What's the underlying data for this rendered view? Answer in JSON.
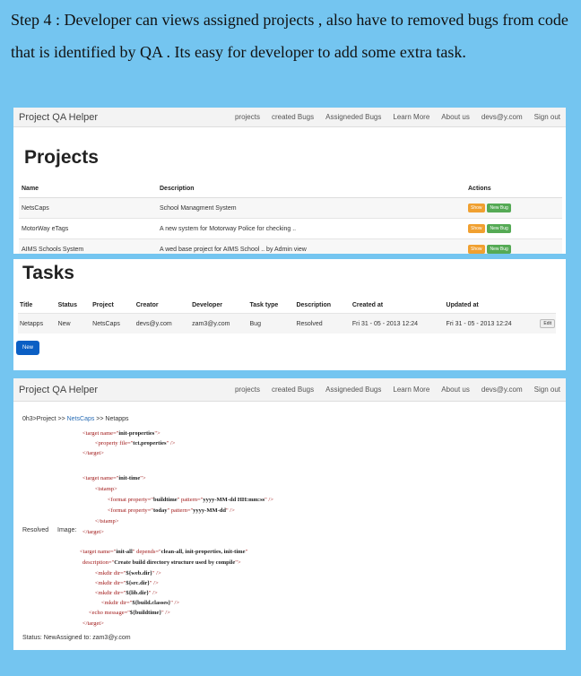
{
  "caption": "Step 4 : Developer can views assigned projects , also have to removed bugs from code that is identified by QA . Its easy for developer to add some extra task.",
  "navbar": {
    "brand": "Project QA Helper",
    "links": [
      "projects",
      "created Bugs",
      "Assigneded Bugs",
      "Learn More",
      "About us",
      "devs@y.com",
      "Sign out"
    ]
  },
  "projects": {
    "title": "Projects",
    "headers": [
      "Name",
      "Description",
      "Actions"
    ],
    "rows": [
      {
        "name": "NetsCaps",
        "description": "School Managment System"
      },
      {
        "name": "MotorWay eTags",
        "description": "A new system for Motorway Police for checking .."
      },
      {
        "name": "AIMS Schools System",
        "description": "A wed base project for AIMS School .. by Admin view"
      }
    ],
    "show_label": "Show",
    "newbug_label": "New Bug"
  },
  "tasks": {
    "title": "Tasks",
    "headers": [
      "Title",
      "Status",
      "Project",
      "Creator",
      "Developer",
      "Task type",
      "Description",
      "Created at",
      "Updated at"
    ],
    "row": [
      "Netapps",
      "New",
      "NetsCaps",
      "devs@y.com",
      "zam3@y.com",
      "Bug",
      "Resolved",
      "Fri 31 - 05 - 2013 12:24",
      "Fri 31 - 05 - 2013 12:24"
    ],
    "edit_label": "Edit",
    "new_label": "New"
  },
  "detail": {
    "crumb_prefix": "0h3>Project >> ",
    "crumb_link": "NetsCaps",
    "crumb_suffix": " >> Netapps",
    "resolved": "Resolved",
    "image_label": "Image:",
    "status_line": "Status: NewAssigned to: zam3@y.com",
    "code": {
      "l1": [
        "<target name=\"",
        "init-properties",
        "\">"
      ],
      "l2": [
        "<property file=\"",
        "tct.properties",
        "\" />"
      ],
      "l3": "</target>",
      "l4": [
        "<target name=\"",
        "init-time",
        "\">"
      ],
      "l5": "<tstamp>",
      "l6": [
        "<format property=\"",
        "buildtime",
        "\" pattern=\"",
        "yyyy-MM-dd HH:mm:ss",
        "\" />"
      ],
      "l7": [
        "<format property=\"",
        "today",
        "\" pattern=\"",
        "yyyy-MM-dd",
        "\" />"
      ],
      "l8": "</tstamp>",
      "l9": "</target>",
      "l10": [
        "<target name=\"",
        "init-all",
        "\" depends=\"",
        "clean-all, init-properties, init-time",
        "\""
      ],
      "l11": [
        "description=\"",
        "Create build directory structure used by compile",
        "\">"
      ],
      "l12": [
        "<mkdir dir=\"",
        "${web.dir}",
        "\" />"
      ],
      "l13": [
        "<mkdir dir=\"",
        "${src.dir}",
        "\" />"
      ],
      "l14": [
        "<mkdir dir=\"",
        "${lib.dir}",
        "\" />"
      ],
      "l15": [
        "<mkdir dir=\"",
        "${build.classes}",
        "\" />"
      ],
      "l16": [
        "<echo message=\"",
        "${buildtime}",
        "\" />"
      ],
      "l17": "</target>"
    }
  },
  "colors": {
    "background": "#74c5f0",
    "show": "#f0a030",
    "newbug": "#55aa55",
    "new_button": "#0b5fc4"
  }
}
